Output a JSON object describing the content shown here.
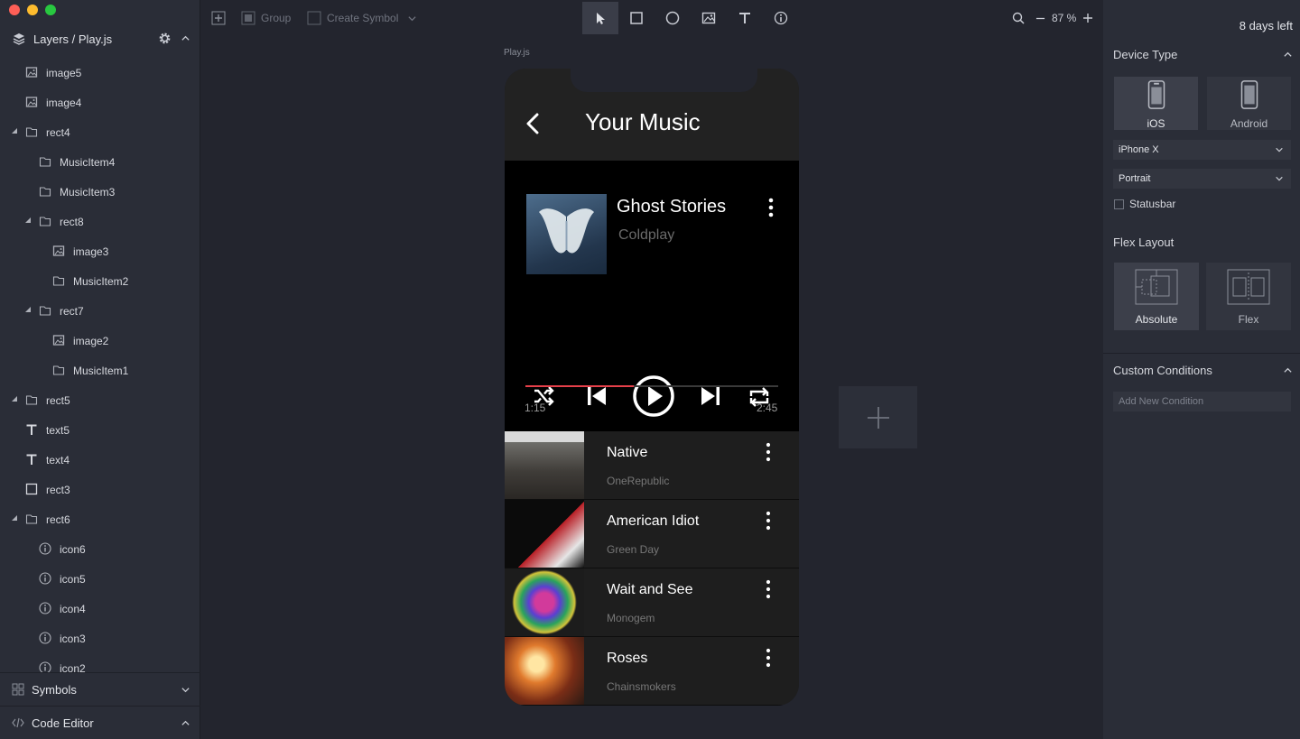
{
  "window": {
    "traffic_lights": {
      "close": "#fe5f57",
      "minimize": "#febc2e",
      "maximize": "#28c840"
    }
  },
  "sidebar": {
    "header_title": "Layers / Play.js",
    "layers": [
      {
        "label": "image5",
        "icon": "image-icon",
        "depth": 0,
        "expanded": null
      },
      {
        "label": "image4",
        "icon": "image-icon",
        "depth": 0,
        "expanded": null
      },
      {
        "label": "rect4",
        "icon": "folder-icon",
        "depth": 0,
        "expanded": true
      },
      {
        "label": "MusicItem4",
        "icon": "folder-icon",
        "depth": 1,
        "expanded": null
      },
      {
        "label": "MusicItem3",
        "icon": "folder-icon",
        "depth": 1,
        "expanded": null
      },
      {
        "label": "rect8",
        "icon": "folder-icon",
        "depth": 1,
        "expanded": true
      },
      {
        "label": "image3",
        "icon": "image-icon",
        "depth": 2,
        "expanded": null
      },
      {
        "label": "MusicItem2",
        "icon": "folder-icon",
        "depth": 2,
        "expanded": null
      },
      {
        "label": "rect7",
        "icon": "folder-icon",
        "depth": 1,
        "expanded": true
      },
      {
        "label": "image2",
        "icon": "image-icon",
        "depth": 2,
        "expanded": null
      },
      {
        "label": "MusicItem1",
        "icon": "folder-icon",
        "depth": 2,
        "expanded": null
      },
      {
        "label": "rect5",
        "icon": "folder-icon",
        "depth": 0,
        "expanded": true
      },
      {
        "label": "text5",
        "icon": "text-icon",
        "depth": 0,
        "expanded": null
      },
      {
        "label": "text4",
        "icon": "text-icon",
        "depth": 0,
        "expanded": null
      },
      {
        "label": "rect3",
        "icon": "square-icon",
        "depth": 0,
        "expanded": null
      },
      {
        "label": "rect6",
        "icon": "folder-icon",
        "depth": 0,
        "expanded": true
      },
      {
        "label": "icon6",
        "icon": "info-icon",
        "depth": 1,
        "expanded": null
      },
      {
        "label": "icon5",
        "icon": "info-icon",
        "depth": 1,
        "expanded": null
      },
      {
        "label": "icon4",
        "icon": "info-icon",
        "depth": 1,
        "expanded": null
      },
      {
        "label": "icon3",
        "icon": "info-icon",
        "depth": 1,
        "expanded": null
      },
      {
        "label": "icon2",
        "icon": "info-icon",
        "depth": 1,
        "expanded": null
      }
    ],
    "symbols_label": "Symbols",
    "code_editor_label": "Code Editor"
  },
  "toolbar": {
    "group_label": "Group",
    "create_symbol_label": "Create Symbol",
    "zoom": "87 %",
    "tools": [
      "select-tool",
      "rectangle-tool",
      "ellipse-tool",
      "image-tool",
      "text-tool",
      "info-tool"
    ],
    "active_tool": "select-tool"
  },
  "right_panel": {
    "trial": "8 days left",
    "device_type_title": "Device Type",
    "devices": [
      {
        "label": "iOS",
        "selected": true
      },
      {
        "label": "Android",
        "selected": false
      }
    ],
    "device_model": "iPhone X",
    "orientation": "Portrait",
    "statusbar_label": "Statusbar",
    "statusbar_checked": false,
    "flex_layout_title": "Flex Layout",
    "layouts": [
      {
        "label": "Absolute",
        "selected": true
      },
      {
        "label": "Flex",
        "selected": false
      }
    ],
    "custom_conditions_title": "Custom Conditions",
    "condition_placeholder": "Add New Condition"
  },
  "canvas": {
    "file_label": "Play.js",
    "app": {
      "title": "Your Music",
      "now_playing": {
        "title": "Ghost Stories",
        "artist": "Coldplay",
        "current_time": "1:15",
        "total_time": "2:45",
        "progress": 0.43,
        "accent": "#e5404a"
      },
      "songs": [
        {
          "title": "Native",
          "artist": "OneRepublic"
        },
        {
          "title": "American Idiot",
          "artist": "Green Day"
        },
        {
          "title": "Wait and See",
          "artist": "Monogem"
        },
        {
          "title": "Roses",
          "artist": "Chainsmokers"
        }
      ]
    }
  }
}
